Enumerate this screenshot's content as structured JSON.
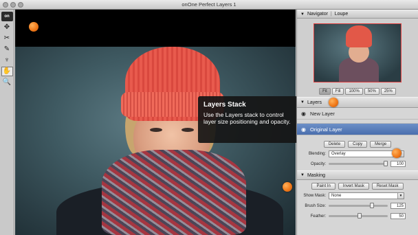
{
  "window": {
    "title": "onOne Perfect Layers 1"
  },
  "toolbar": {
    "tools": [
      {
        "name": "logo",
        "glyph": "on"
      },
      {
        "name": "move-tool",
        "glyph": "✥"
      },
      {
        "name": "crop-tool",
        "glyph": "✂"
      },
      {
        "name": "brush-tool",
        "glyph": "✎"
      },
      {
        "name": "retouch-tool",
        "glyph": "♆"
      },
      {
        "name": "hand-tool",
        "glyph": "✋"
      },
      {
        "name": "zoom-tool",
        "glyph": "🔍"
      }
    ]
  },
  "tooltip": {
    "title": "Layers Stack",
    "body": "Use the Layers stack to control layer size positioning and opacity."
  },
  "navigator": {
    "tab_navigator": "Navigator",
    "tab_loupe": "Loupe",
    "zoom_buttons": [
      "Fit",
      "Fill",
      "100%",
      "50%",
      "25%"
    ],
    "selected_zoom": "Fit"
  },
  "layers": {
    "title": "Layers",
    "items": [
      {
        "label": "New Layer"
      },
      {
        "label": "Original Layer"
      }
    ],
    "buttons": {
      "delete": "Delete",
      "copy": "Copy",
      "merge": "Merge"
    },
    "blending_label": "Blending:",
    "blending_value": "Overlay",
    "opacity_label": "Opacity:",
    "opacity_value": "100"
  },
  "masking": {
    "title": "Masking",
    "buttons": {
      "paint_in": "Paint In",
      "invert_mask": "Invert Mask",
      "reset_mask": "Reset Mask"
    },
    "show_mask_label": "Show Mask:",
    "show_mask_value": "None",
    "brush_size_label": "Brush Size:",
    "brush_size_value": "125",
    "feather_label": "Feather:",
    "feather_value": "50"
  },
  "colors": {
    "accent_dot": "#f07a1a",
    "selection": "#4a6fae"
  }
}
